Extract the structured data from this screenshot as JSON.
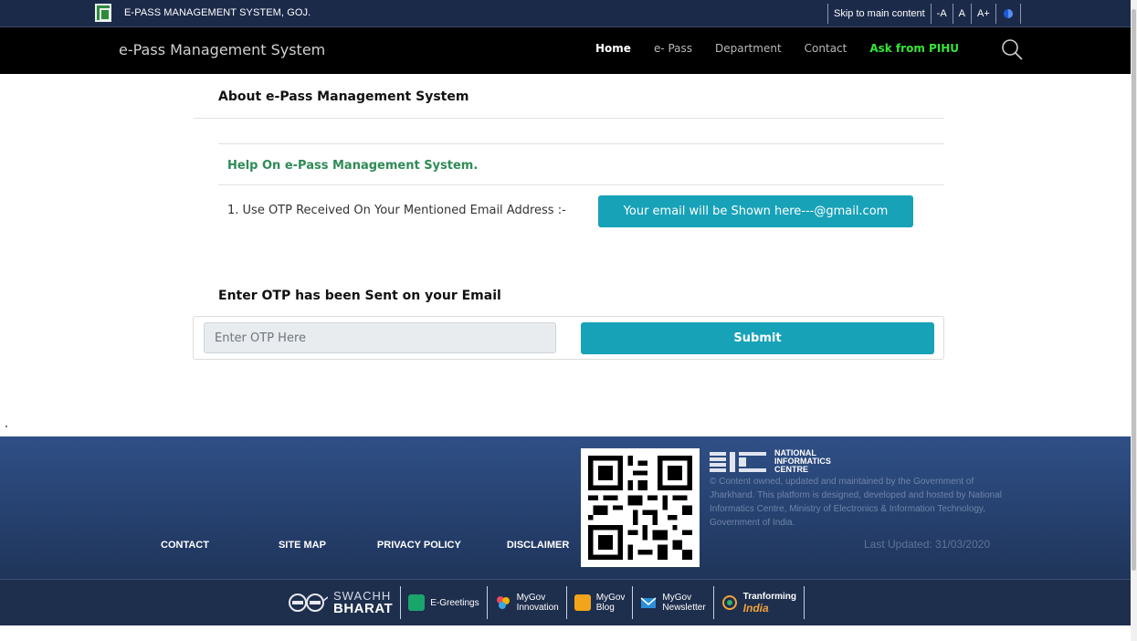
{
  "topbar": {
    "site_name": "E-PASS MANAGEMENT SYSTEM, GOJ.",
    "skip_link": "Skip to main content",
    "font_decrease": "-A",
    "font_normal": "A",
    "font_increase": "A+"
  },
  "navbar": {
    "brand": "e-Pass Management System",
    "items": [
      {
        "label": "Home",
        "active": true
      },
      {
        "label": "e- Pass"
      },
      {
        "label": "Department"
      },
      {
        "label": "Contact"
      },
      {
        "label": "Ask from PIHU"
      }
    ],
    "search_icon": "search-icon"
  },
  "main": {
    "about_title": "About e-Pass Management System",
    "help_title": "Help On e-Pass Management System.",
    "otp_instruction": "1. Use OTP Received On Your Mentioned Email Address :-",
    "email_display": "Your email will be Shown here---@gmail.com",
    "otp_heading": "Enter OTP has been Sent on your Email",
    "otp_placeholder": "Enter OTP Here",
    "otp_value": "",
    "submit_label": "Submit"
  },
  "footer": {
    "links": [
      "CONTACT",
      "SITE MAP",
      "PRIVACY POLICY",
      "DISCLAIMER"
    ],
    "nic_logo_lines": [
      "NATIONAL",
      "INFORMATICS",
      "CENTRE"
    ],
    "nic_text": "© Content owned, updated and maintained by the Government of Jharkhand. This platform is designed, developed and hosted by National Informatics Centre, Ministry of Electronics & Information Technology, Government of India.",
    "last_updated": "Last Updated: 31/03/2020"
  },
  "partners": {
    "swachh_1": "SWACHH",
    "swachh_2": "BHARAT",
    "egreetings": "E-Greetings",
    "mygov_innovation_1": "MyGov",
    "mygov_innovation_2": "Innovation",
    "mygov_blog_1": "MyGov",
    "mygov_blog_2": "Blog",
    "mygov_newsletter_1": "MyGov",
    "mygov_newsletter_2": "Newsletter",
    "transforming_1": "Tran",
    "transforming_2": "forming",
    "transforming_3": "India"
  },
  "colors": {
    "topbar": "#1c2a4a",
    "navbar": "#000000",
    "accent": "#17a2b8",
    "help_green": "#2e8b57",
    "ask_green": "#35e535",
    "footer": "#2f4f86"
  }
}
